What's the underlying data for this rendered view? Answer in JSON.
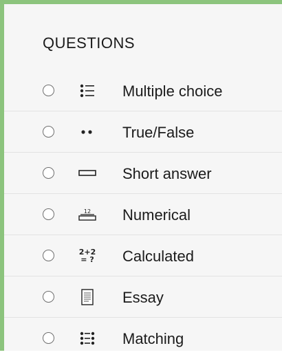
{
  "section": {
    "title": "QUESTIONS"
  },
  "questions": [
    {
      "label": "Multiple choice",
      "icon": "multiple-choice-icon"
    },
    {
      "label": "True/False",
      "icon": "true-false-icon"
    },
    {
      "label": "Short answer",
      "icon": "short-answer-icon"
    },
    {
      "label": "Numerical",
      "icon": "numerical-icon",
      "icon_text": "12"
    },
    {
      "label": "Calculated",
      "icon": "calculated-icon",
      "icon_text_top": "2+2",
      "icon_text_bottom": "= ?"
    },
    {
      "label": "Essay",
      "icon": "essay-icon"
    },
    {
      "label": "Matching",
      "icon": "matching-icon"
    }
  ],
  "colors": {
    "accent_border": "#8cc47d",
    "panel_bg": "#f6f6f6"
  }
}
